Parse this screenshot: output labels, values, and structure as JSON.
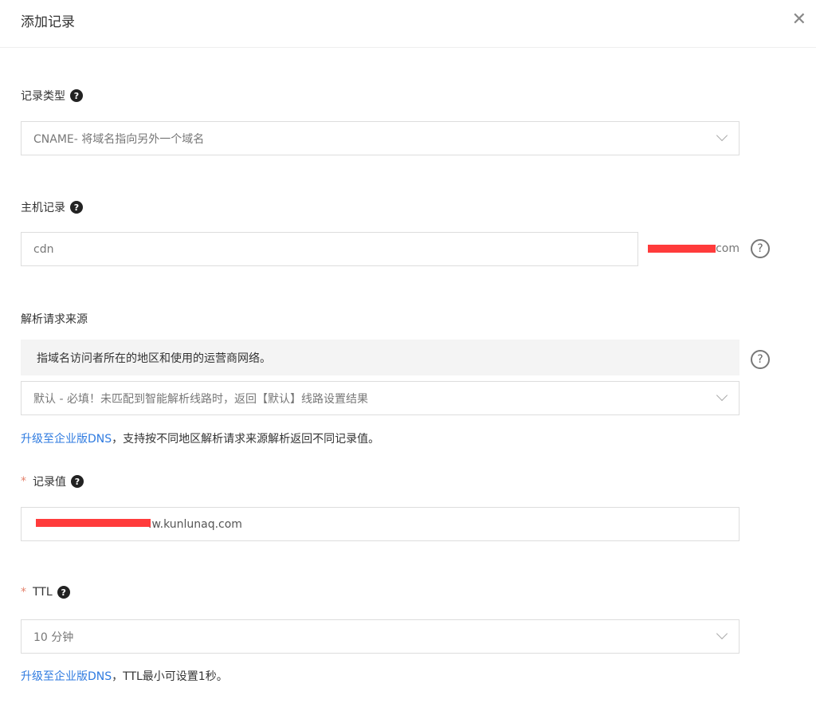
{
  "dialog": {
    "title": "添加记录",
    "close": "✕"
  },
  "record_type": {
    "label": "记录类型",
    "help": "?",
    "value": "CNAME- 将域名指向另外一个域名"
  },
  "host": {
    "label": "主机记录",
    "help": "?",
    "value": "cdn",
    "suffix": ".com",
    "help_icon": "?"
  },
  "source": {
    "label": "解析请求来源",
    "info": "指域名访问者所在的地区和使用的运营商网络。",
    "help_icon": "?",
    "value": "默认 - 必填！未匹配到智能解析线路时，返回【默认】线路设置结果",
    "upgrade_link": "升级至企业版DNS",
    "upgrade_text": "，支持按不同地区解析请求来源解析返回不同记录值。"
  },
  "value": {
    "required": "*",
    "label": "记录值",
    "help": "?",
    "value": ".w.kunlunaq.com"
  },
  "ttl": {
    "required": "*",
    "label": "TTL",
    "help": "?",
    "value": "10 分钟",
    "upgrade_link": "升级至企业版DNS",
    "upgrade_text": "，TTL最小可设置1秒。"
  }
}
